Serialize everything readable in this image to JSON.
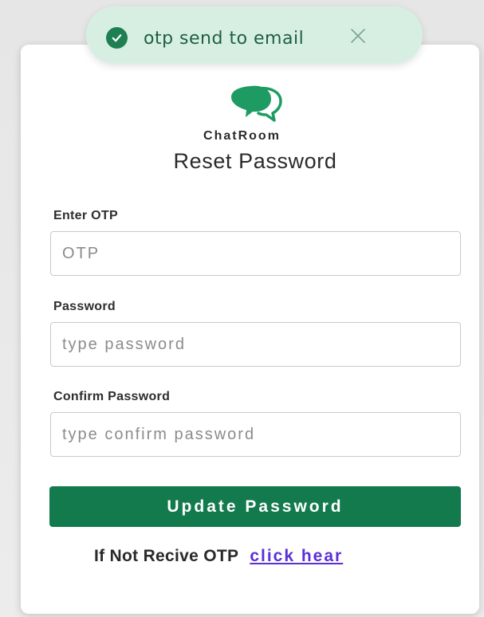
{
  "toast": {
    "message": "otp send to email",
    "icon": "check-circle-icon",
    "close_icon": "close-icon"
  },
  "brand": {
    "name": "ChatRoom",
    "logo_icon": "chat-bubbles-icon",
    "logo_color": "#1e9b63"
  },
  "page_title": "Reset Password",
  "form": {
    "otp": {
      "label": "Enter OTP",
      "placeholder": "OTP",
      "value": ""
    },
    "password": {
      "label": "Password",
      "placeholder": "type password",
      "value": ""
    },
    "confirm_password": {
      "label": "Confirm Password",
      "placeholder": "type confirm password",
      "value": ""
    },
    "submit_label": "Update Password"
  },
  "footer": {
    "text": "If Not Recive OTP",
    "link_label": "click hear"
  },
  "colors": {
    "primary": "#137a4e",
    "toast_bg": "#d7efe3",
    "link": "#5a2fd6"
  }
}
